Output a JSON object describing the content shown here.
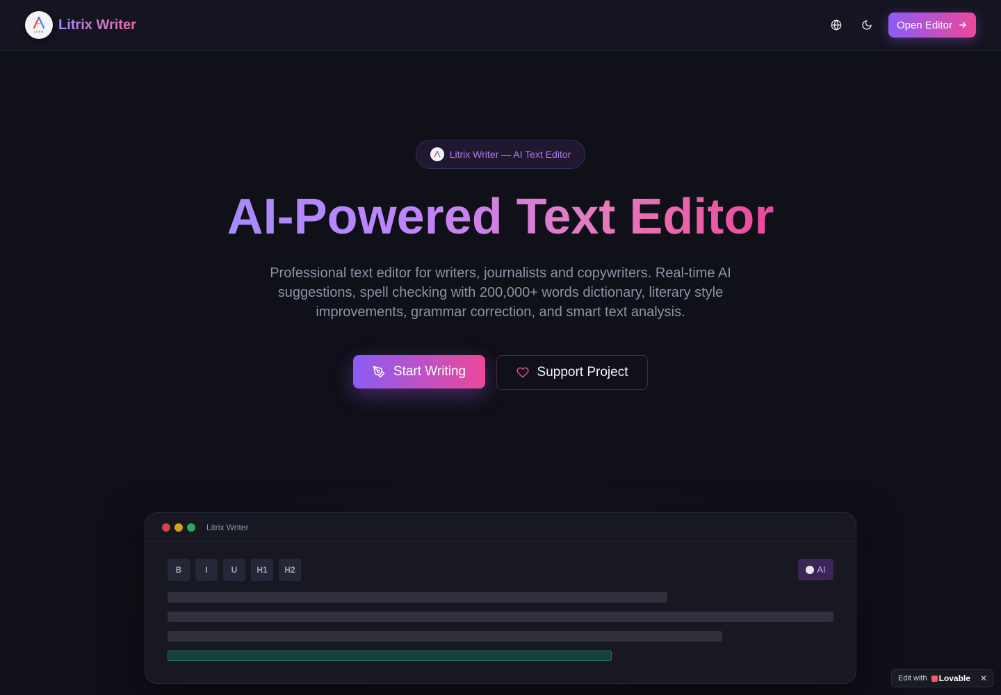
{
  "header": {
    "brand_name": "Litrix Writer",
    "logo_text": "LITRIX",
    "open_editor_label": "Open Editor"
  },
  "hero": {
    "badge_text": "Litrix Writer — AI Text Editor",
    "title": "AI-Powered Text Editor",
    "subtitle": "Professional text editor for writers, journalists and copywriters. Real-time AI suggestions, spell checking with 200,000+ words dictionary, literary style improvements, grammar correction, and smart text analysis.",
    "primary_cta": "Start Writing",
    "secondary_cta": "Support Project"
  },
  "preview": {
    "window_title": "Litrix Writer",
    "toolbar": [
      "B",
      "I",
      "U",
      "H1",
      "H2"
    ],
    "ai_label": "AI"
  },
  "lovable": {
    "edit_with": "Edit with",
    "brand": "Lovable",
    "close": "✕"
  },
  "colors": {
    "background": "#0f1018",
    "accent_start": "#8b5cf6",
    "accent_end": "#ec4899",
    "muted_text": "#8b93a7"
  }
}
